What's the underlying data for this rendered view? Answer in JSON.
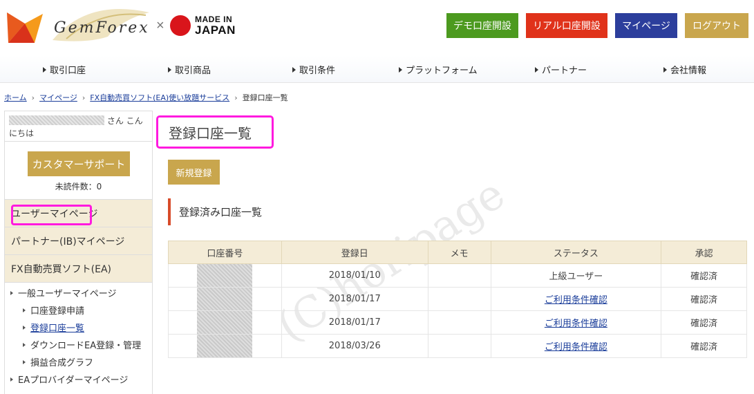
{
  "header": {
    "logo_text": "GemForex",
    "times": "×",
    "made_in": "MADE IN",
    "japan": "JAPAN",
    "buttons": {
      "demo": "デモ口座開設",
      "real": "リアル口座開設",
      "mypage": "マイページ",
      "logout": "ログアウト"
    },
    "colors": {
      "demo": "#4c9a1f",
      "real": "#e0321a",
      "mypage": "#2c3e9c",
      "logout": "#c9a64d"
    }
  },
  "nav": [
    "取引口座",
    "取引商品",
    "取引条件",
    "プラットフォーム",
    "パートナー",
    "会社情報"
  ],
  "breadcrumb": {
    "home": "ホーム",
    "mypage": "マイページ",
    "ea": "FX自動売買ソフト(EA)使い放題サービス",
    "current": "登録口座一覧"
  },
  "sidebar": {
    "greeting": "さん こんにちは",
    "support_button": "カスタマーサポート",
    "unread": "未読件数：0",
    "sections": [
      "ユーザーマイページ",
      "パートナー(IB)マイページ",
      "FX自動売買ソフト(EA)"
    ],
    "sub_items": {
      "general": "一般ユーザーマイページ",
      "apply": "口座登録申請",
      "list": "登録口座一覧",
      "download": "ダウンロードEA登録・管理",
      "graph": "損益合成グラフ",
      "provider": "EAプロバイダーマイページ"
    }
  },
  "main": {
    "title": "登録口座一覧",
    "new_button": "新規登録",
    "subheading": "登録済み口座一覧",
    "table": {
      "headers": [
        "口座番号",
        "登録日",
        "メモ",
        "ステータス",
        "承認"
      ],
      "rows": [
        {
          "date": "2018/01/10",
          "memo": "",
          "status": "上級ユーザー",
          "status_link": false,
          "approval": "確認済"
        },
        {
          "date": "2018/01/17",
          "memo": "",
          "status": "ご利用条件確認",
          "status_link": true,
          "approval": "確認済"
        },
        {
          "date": "2018/01/17",
          "memo": "",
          "status": "ご利用条件確認",
          "status_link": true,
          "approval": "確認済"
        },
        {
          "date": "2018/03/26",
          "memo": "",
          "status": "ご利用条件確認",
          "status_link": true,
          "approval": "確認済"
        }
      ]
    }
  },
  "watermark": "(C)horipage",
  "highlight_color": "#ff1adf"
}
